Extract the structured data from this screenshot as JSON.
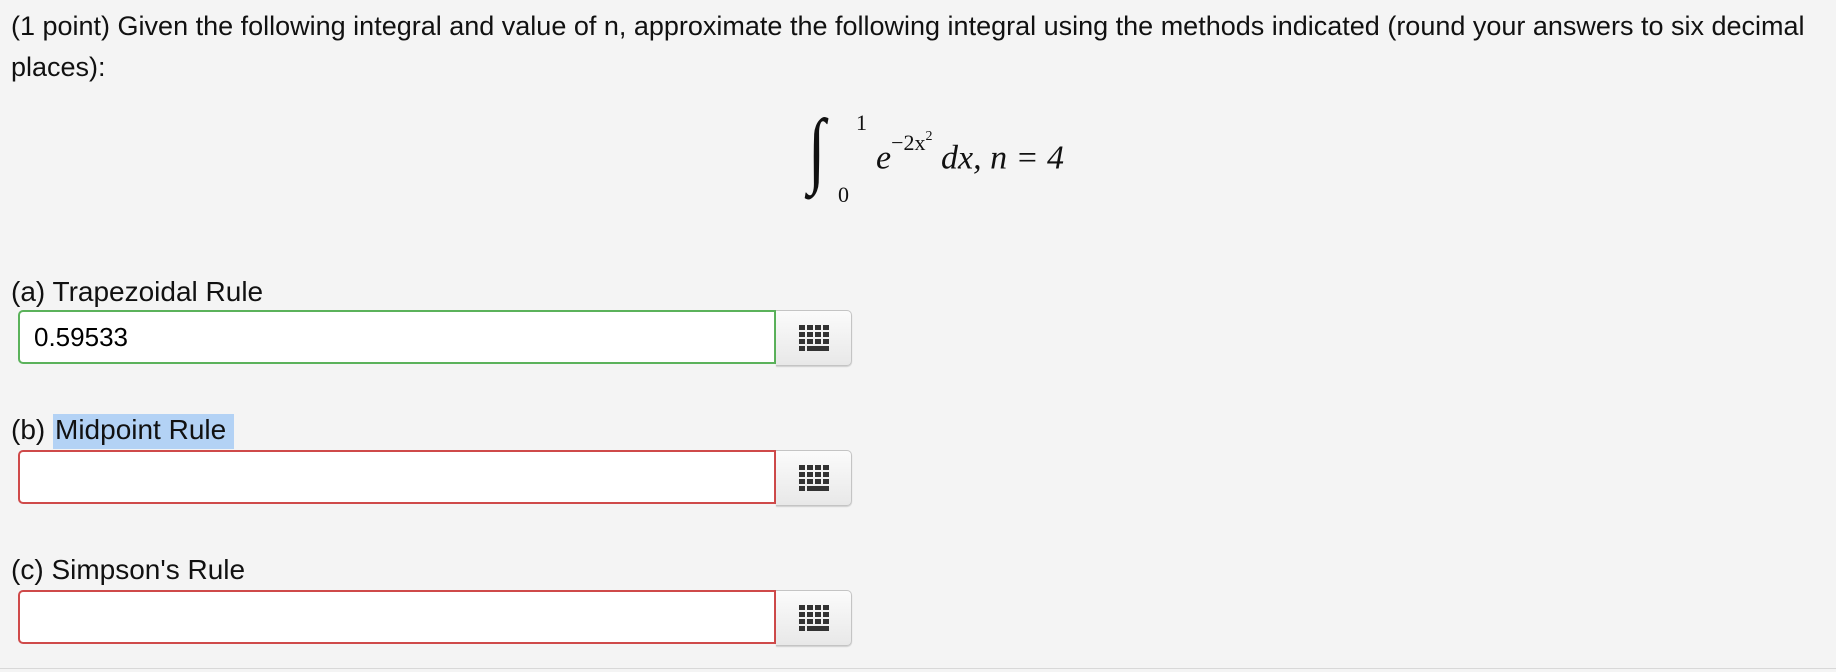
{
  "problem": {
    "prompt": "(1 point) Given the following integral and value of n, approximate the following integral using the methods indicated (round your answers to six decimal places):"
  },
  "formula": {
    "integral_sign": "∫",
    "upper_limit": "1",
    "lower_limit": "0",
    "base": "e",
    "exponent_prefix": "−2x",
    "exponent_power": "2",
    "rest": "dx, n = 4"
  },
  "parts": [
    {
      "prefix": "(a) ",
      "label": "Trapezoidal Rule",
      "value": "0.59533",
      "status": "correct",
      "button_icon": "grid-icon"
    },
    {
      "prefix": "(b) ",
      "label": "Midpoint Rule",
      "value": "",
      "status": "incorrect",
      "button_icon": "grid-icon"
    },
    {
      "prefix": "(c) ",
      "label": "Simpson's Rule",
      "value": "",
      "status": "incorrect",
      "button_icon": "grid-icon"
    }
  ],
  "colors": {
    "correct_border": "#5bb25b",
    "incorrect_border": "#cf4a4a",
    "selection_highlight": "#b3d2f5",
    "background": "#f4f4f4"
  }
}
